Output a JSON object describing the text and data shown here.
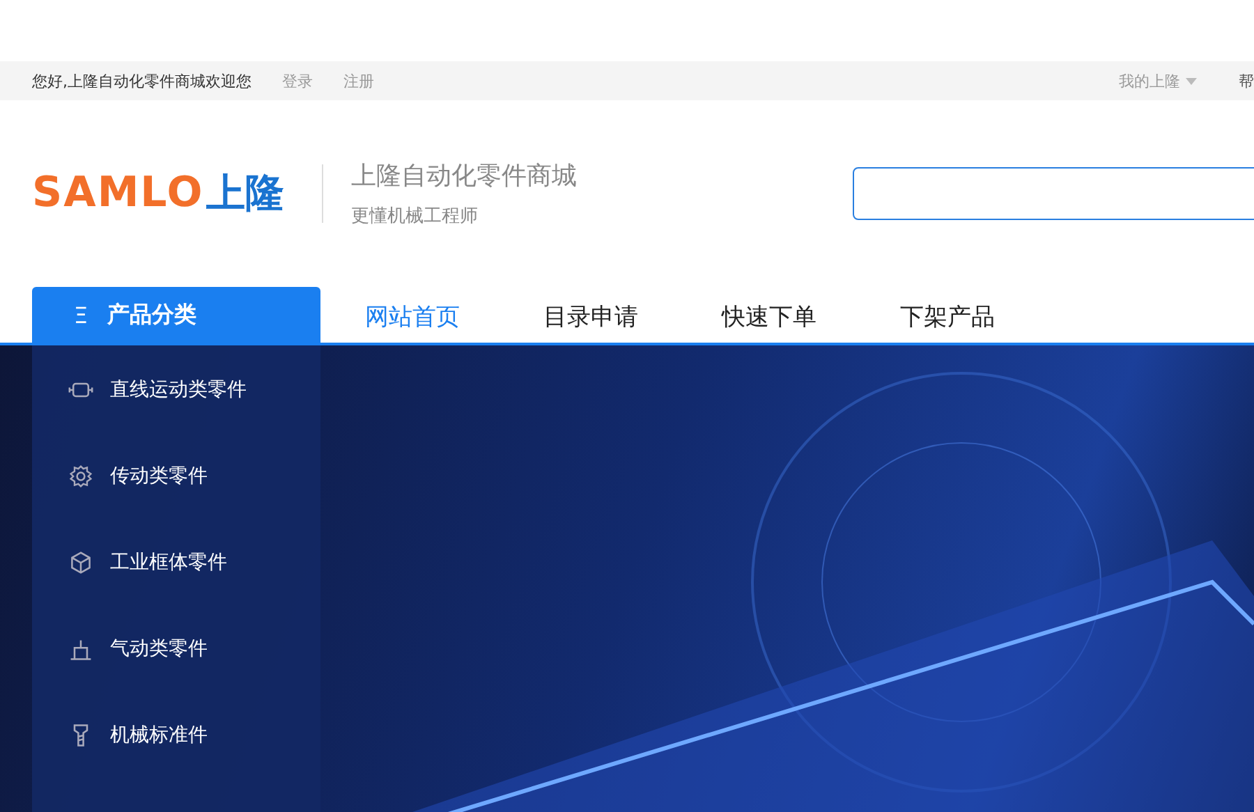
{
  "top_bar": {
    "greeting": "您好,上隆自动化零件商城欢迎您",
    "links": [
      "登录",
      "注册"
    ],
    "my_account": "我的上隆",
    "help": "帮"
  },
  "header": {
    "logo_latin": "SAMLO",
    "logo_chinese": "上隆",
    "site_name": "上隆自动化零件商城",
    "slogan": "更懂机械工程师"
  },
  "category_button": {
    "icon": "Ξ",
    "label": "产品分类"
  },
  "nav": [
    {
      "label": "网站首页",
      "selected": true
    },
    {
      "label": "目录申请",
      "selected": false
    },
    {
      "label": "快速下单",
      "selected": false
    },
    {
      "label": "下架产品",
      "selected": false
    }
  ],
  "categories": [
    {
      "kind": "linear",
      "label": "直线运动类零件"
    },
    {
      "kind": "gear",
      "label": "传动类零件"
    },
    {
      "kind": "cube",
      "label": "工业框体零件"
    },
    {
      "kind": "pneumatic",
      "label": "气动类零件"
    },
    {
      "kind": "screw",
      "label": "机械标准件"
    }
  ]
}
